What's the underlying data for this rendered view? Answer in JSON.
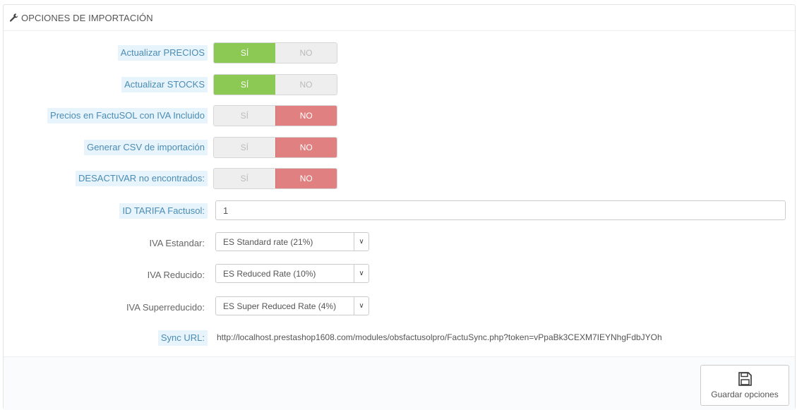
{
  "panel": {
    "title": "OPCIONES DE IMPORTACIÓN",
    "icon": "wrench-icon"
  },
  "switch_labels": {
    "yes": "SÍ",
    "no": "NO"
  },
  "switches": [
    {
      "label": "Actualizar PRECIOS",
      "value": "yes"
    },
    {
      "label": "Actualizar STOCKS",
      "value": "yes"
    },
    {
      "label": "Precios en FactuSOL con IVA Incluido",
      "value": "no"
    },
    {
      "label": "Generar CSV de importación",
      "value": "no"
    },
    {
      "label": "DESACTIVAR no encontrados:",
      "value": "no"
    }
  ],
  "tarifa": {
    "label": "ID TARIFA Factusol:",
    "value": "1"
  },
  "selects": [
    {
      "label": "IVA Estandar:",
      "value": "ES Standard rate (21%)"
    },
    {
      "label": "IVA Reducido:",
      "value": "ES Reduced Rate (10%)"
    },
    {
      "label": "IVA Superreducido:",
      "value": "ES Super Reduced Rate (4%)"
    }
  ],
  "sync": {
    "label": "Sync URL:",
    "url": "http://localhost.prestashop1608.com/modules/obsfactusolpro/FactuSync.php?token=vPpaBk3CEXM7IEYNhgFdbJYOh"
  },
  "footer": {
    "save_label": "Guardar opciones",
    "save_icon": "floppy-disk-icon"
  },
  "colors": {
    "yes_active": "#8bc954",
    "no_active": "#e08080",
    "hint_bg": "#e8f4fb",
    "hint_text": "#4a8cb5"
  }
}
